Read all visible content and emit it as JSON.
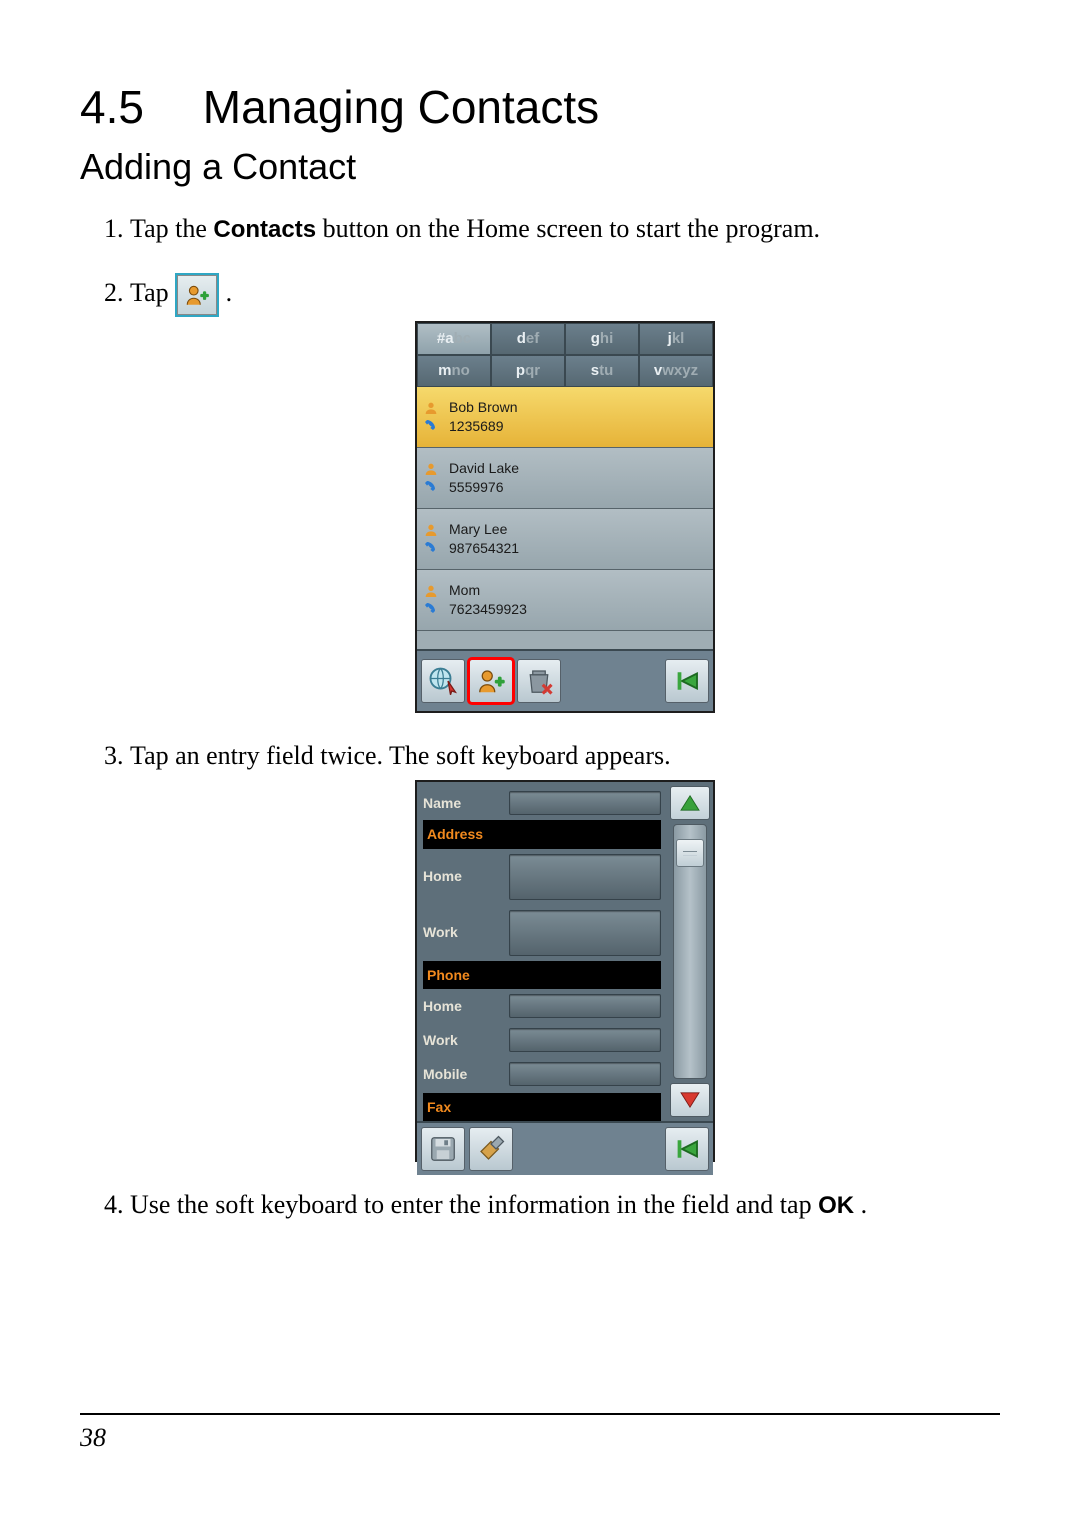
{
  "section": {
    "number": "4.5",
    "title": "Managing Contacts"
  },
  "subsection": {
    "title": "Adding a Contact"
  },
  "steps": {
    "s1_pre": "Tap the ",
    "s1_bold": "Contacts",
    "s1_post": " button on the Home screen to start the program.",
    "s2_pre": "Tap ",
    "s2_post": ".",
    "s3": "Tap an entry field twice. The soft keyboard appears.",
    "s4_pre": "Use the soft keyboard to enter the information in the field and tap ",
    "s4_bold": "OK",
    "s4_post": "."
  },
  "page_number": "38",
  "contacts_screen": {
    "tabs": [
      "#abc",
      "def",
      "ghi",
      "jkl",
      "mno",
      "pqr",
      "stu",
      "vwxyz"
    ],
    "selected_tab_index": 0,
    "contacts": [
      {
        "name": "Bob Brown",
        "number": "1235689",
        "selected": true
      },
      {
        "name": "David Lake",
        "number": "5559976",
        "selected": false
      },
      {
        "name": "Mary Lee",
        "number": "987654321",
        "selected": false
      },
      {
        "name": "Mom",
        "number": "7623459923",
        "selected": false
      }
    ],
    "toolbar_icons": [
      "globe-pin-icon",
      "add-contact-icon",
      "delete-icon",
      "back-icon"
    ],
    "highlighted_toolbar_index": 1
  },
  "edit_screen": {
    "fields": [
      {
        "type": "row",
        "label": "Name",
        "size": "small"
      },
      {
        "type": "section",
        "label": "Address"
      },
      {
        "type": "row",
        "label": "Home",
        "size": "big"
      },
      {
        "type": "row",
        "label": "Work",
        "size": "big"
      },
      {
        "type": "section",
        "label": "Phone"
      },
      {
        "type": "row",
        "label": "Home",
        "size": "small"
      },
      {
        "type": "row",
        "label": "Work",
        "size": "small"
      },
      {
        "type": "row",
        "label": "Mobile",
        "size": "small"
      },
      {
        "type": "section",
        "label": "Fax"
      }
    ],
    "toolbar_icons": [
      "save-icon",
      "clear-icon",
      "back-icon"
    ]
  },
  "icon_names": {
    "person": "person-icon",
    "phone": "phone-icon",
    "add_contact": "add-contact-icon",
    "globe_pin": "globe-pin-icon",
    "delete": "delete-icon",
    "back": "back-icon",
    "save": "save-icon",
    "clear": "clear-icon",
    "scroll_up": "scroll-up-icon",
    "scroll_down": "scroll-down-icon"
  }
}
